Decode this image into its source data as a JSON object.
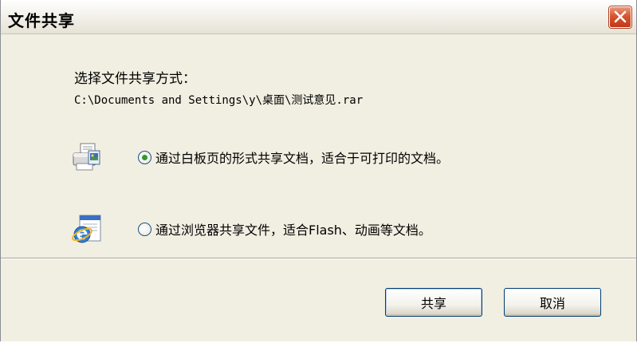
{
  "window": {
    "title": "文件共享"
  },
  "content": {
    "heading": "选择文件共享方式：",
    "file_path": "C:\\Documents and Settings\\y\\桌面\\测试意见.rar",
    "options": [
      {
        "label": "通过白板页的形式共享文档，适合于可打印的文档。",
        "icon": "printer-document-icon",
        "selected": true
      },
      {
        "label": "通过浏览器共享文件，适合Flash、动画等文档。",
        "icon": "internet-explorer-icon",
        "selected": false
      }
    ]
  },
  "buttons": {
    "share_label": "共享",
    "cancel_label": "取消"
  },
  "colors": {
    "window_bg": "#f1efe2",
    "close_red": "#d6542f",
    "radio_selected": "#2f9a2f"
  }
}
